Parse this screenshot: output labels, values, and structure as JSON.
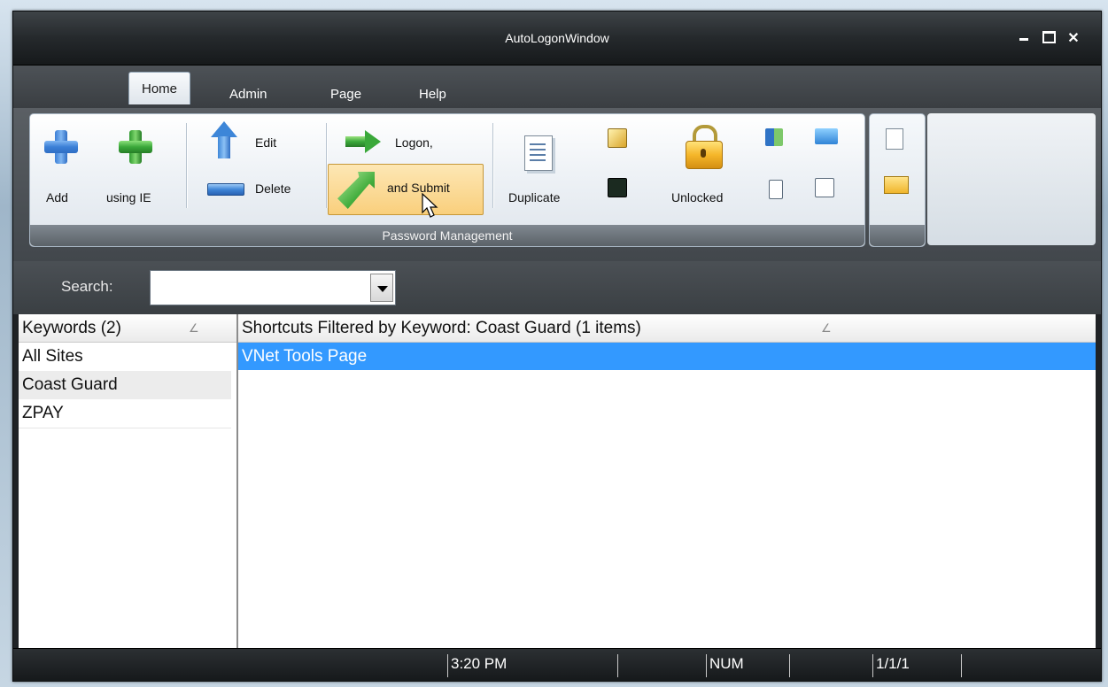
{
  "window": {
    "title": "AutoLogonWindow",
    "controls": {
      "minimize": "_",
      "close": "✕"
    }
  },
  "tabs": [
    {
      "label": "Home",
      "active": true
    },
    {
      "label": "Admin",
      "active": false
    },
    {
      "label": "Page",
      "active": false
    },
    {
      "label": "Help",
      "active": false
    }
  ],
  "ribbon": {
    "group_caption": "Password Management",
    "add_label": "Add",
    "add_ie_label": "using IE",
    "edit_label": "Edit",
    "delete_label": "Delete",
    "logon_label": "Logon,",
    "submit_label": "and Submit",
    "duplicate_label": "Duplicate",
    "unlocked_label": "Unlocked"
  },
  "search": {
    "label": "Search:",
    "value": ""
  },
  "keywords": {
    "header": "Keywords (2)",
    "items": [
      "All Sites",
      "Coast Guard",
      "ZPAY"
    ],
    "selected": "Coast Guard"
  },
  "shortcuts": {
    "header": "Shortcuts Filtered by Keyword: Coast Guard (1 items)",
    "items": [
      "VNet Tools Page"
    ]
  },
  "status": {
    "time": "3:20 PM",
    "num": "NUM",
    "page": "1/1/1"
  },
  "colors": {
    "selection": "#3399ff",
    "titlebar": "#25292c",
    "ribbon_bg": "#eef2f6"
  }
}
